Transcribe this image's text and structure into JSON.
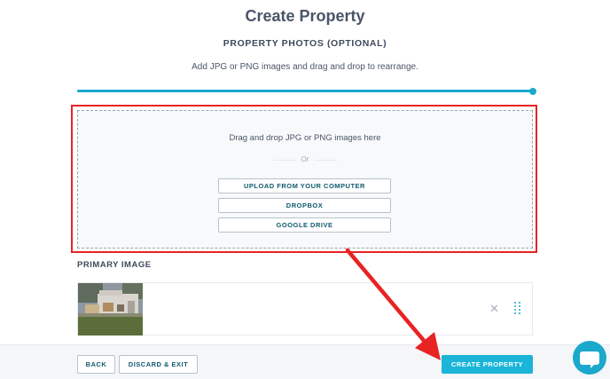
{
  "page": {
    "title": "Create Property",
    "section_heading": "PROPERTY PHOTOS (OPTIONAL)",
    "subtitle": "Add JPG or PNG images and drag and drop to rearrange."
  },
  "progress": {
    "fraction": 1.0
  },
  "dropzone": {
    "prompt": "Drag and drop JPG or PNG images here",
    "or_label": "Or",
    "buttons": {
      "upload": "UPLOAD FROM YOUR COMPUTER",
      "dropbox": "DROPBOX",
      "google_drive": "GOOGLE DRIVE"
    }
  },
  "primary_image": {
    "label": "PRIMARY IMAGE",
    "remove_icon": "close-icon",
    "drag_icon": "drag-handle-icon"
  },
  "footer": {
    "back": "BACK",
    "discard": "DISCARD & EXIT",
    "create": "CREATE PROPERTY"
  },
  "chat": {
    "icon": "chat-bubble-icon"
  },
  "colors": {
    "accent": "#1aa8cc",
    "primary_button": "#1ab5d8",
    "annotation": "#e82323"
  }
}
